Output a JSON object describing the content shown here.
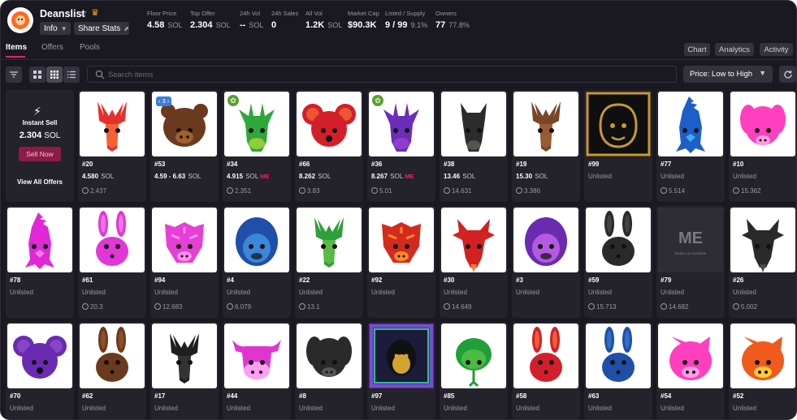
{
  "collection": {
    "name": "Deanslist",
    "info_label": "Info",
    "share_label": "Share Stats"
  },
  "stats": [
    {
      "label": "Floor Price",
      "value": "4.58",
      "unit": "SOL"
    },
    {
      "label": "Top Offer",
      "value": "2.304",
      "unit": "SOL"
    },
    {
      "label": "24h Vol",
      "value": "--",
      "unit": "SOL"
    },
    {
      "label": "24h Sales",
      "value": "0",
      "unit": ""
    },
    {
      "label": "All Vol",
      "value": "1.2K",
      "unit": "SOL"
    },
    {
      "label": "Market Cap",
      "value": "$90.3K",
      "unit": ""
    },
    {
      "label": "Listed / Supply",
      "value": "9 / 99",
      "unit": "9.1%"
    },
    {
      "label": "Owners",
      "value": "77",
      "unit": "77.8%"
    }
  ],
  "tabs": [
    "Items",
    "Offers",
    "Pools"
  ],
  "right_buttons": [
    "Chart",
    "Analytics",
    "Activity"
  ],
  "search": {
    "placeholder": "Search items"
  },
  "sort": {
    "selected": "Price: Low to High"
  },
  "instant_sell": {
    "title": "Instant Sell",
    "price": "2.304",
    "unit": "SOL",
    "button": "Sell Now",
    "view_all": "View All Offers"
  },
  "items": [
    {
      "num": "#20",
      "price": "4.580",
      "unit": "SOL",
      "rank": "2.437",
      "shape": "antler",
      "color": "#e5312e",
      "color2": "#ff8a3d"
    },
    {
      "num": "#53",
      "price": "4.59 - 6.63",
      "unit": "SOL",
      "rank": "",
      "shape": "bear",
      "color": "#6b3a1e",
      "color2": "#a0612f",
      "badge": "3"
    },
    {
      "num": "#34",
      "price": "4.915",
      "unit": "SOL",
      "me": "ME",
      "rank": "2.351",
      "shape": "giraffe",
      "color": "#2fa83a",
      "color2": "#d7e33a",
      "green": "true"
    },
    {
      "num": "#66",
      "price": "8.262",
      "unit": "SOL",
      "rank": "3.83",
      "shape": "mouse",
      "color": "#d31f2a",
      "color2": "#ff7b3a"
    },
    {
      "num": "#36",
      "price": "8.267",
      "unit": "SOL",
      "me": "ME",
      "rank": "5.01",
      "shape": "giraffe",
      "color": "#6b2db8",
      "color2": "#a74ad8",
      "green": "true"
    },
    {
      "num": "#38",
      "price": "13.46",
      "unit": "SOL",
      "rank": "14.631",
      "shape": "horse",
      "color": "#2c2c2c",
      "color2": "#555555"
    },
    {
      "num": "#19",
      "price": "15.30",
      "unit": "SOL",
      "rank": "3.386",
      "shape": "antler",
      "color": "#7a4628",
      "color2": "#b07040"
    },
    {
      "num": "#99",
      "status": "Unlisted",
      "shape": "gorilla-gold",
      "color": "#c99a2e",
      "color2": "#0f0f0f"
    },
    {
      "num": "#77",
      "status": "Unlisted",
      "rank": "5.514",
      "shape": "rooster",
      "color": "#1e5fc7",
      "color2": "#3bb0f0"
    },
    {
      "num": "#10",
      "status": "Unlisted",
      "rank": "15.362",
      "shape": "dog",
      "color": "#ff3fbe",
      "color2": "#ff9be6"
    },
    {
      "num": "#78",
      "status": "Unlisted",
      "shape": "rooster",
      "color": "#e028d6",
      "color2": "#ff7ce8"
    },
    {
      "num": "#61",
      "status": "Unlisted",
      "rank": "20.3",
      "shape": "rabbit",
      "color": "#e236d6",
      "color2": "#ff9af0"
    },
    {
      "num": "#94",
      "status": "Unlisted",
      "rank": "12.683",
      "shape": "tiger",
      "color": "#e53fd3",
      "color2": "#ff8df0"
    },
    {
      "num": "#4",
      "status": "Unlisted",
      "rank": "6.079",
      "shape": "gorilla",
      "color": "#1f4fa8",
      "color2": "#3b86d8"
    },
    {
      "num": "#22",
      "status": "Unlisted",
      "rank": "13.1",
      "shape": "antler",
      "color": "#2f9f3a",
      "color2": "#7bd14a"
    },
    {
      "num": "#92",
      "status": "Unlisted",
      "shape": "tiger",
      "color": "#d42a1e",
      "color2": "#ff8a2a"
    },
    {
      "num": "#30",
      "status": "Unlisted",
      "rank": "14.649",
      "shape": "goat",
      "color": "#d32020",
      "color2": "#ff7a3a"
    },
    {
      "num": "#3",
      "status": "Unlisted",
      "shape": "gorilla",
      "color": "#6a2bb0",
      "color2": "#b25ae0"
    },
    {
      "num": "#59",
      "status": "Unlisted",
      "rank": "15.713",
      "shape": "rabbit",
      "color": "#2a2a2a",
      "color2": "#555555"
    },
    {
      "num": "#79",
      "status": "Unlisted",
      "rank": "14.682",
      "shape": "placeholder",
      "color": "#2e2d33",
      "color2": "#7a7980",
      "ph_text": "Media not available"
    },
    {
      "num": "#26",
      "status": "Unlisted",
      "rank": "5.002",
      "shape": "goat",
      "color": "#2a2a2a",
      "color2": "#4a4a4a"
    },
    {
      "num": "#70",
      "status": "Unlisted",
      "shape": "mouse",
      "color": "#6a2bb0",
      "color2": "#9b59d8"
    },
    {
      "num": "#62",
      "status": "Unlisted",
      "shape": "rabbit",
      "color": "#6b3a1e",
      "color2": "#a0612f"
    },
    {
      "num": "#17",
      "status": "Unlisted",
      "shape": "antler",
      "color": "#1f1f1f",
      "color2": "#444444"
    },
    {
      "num": "#44",
      "status": "Unlisted",
      "shape": "cow",
      "color": "#e036d0",
      "color2": "#ff9ef2"
    },
    {
      "num": "#8",
      "status": "Unlisted",
      "shape": "dog",
      "color": "#2a2a2a",
      "color2": "#555555"
    },
    {
      "num": "#97",
      "status": "Unlisted",
      "shape": "gorilla-rainbow",
      "color": "#d4a52e",
      "color2": "#1b1b3a"
    },
    {
      "num": "#85",
      "status": "Unlisted",
      "shape": "snake",
      "color": "#1f9f3a",
      "color2": "#7ad84a"
    },
    {
      "num": "#58",
      "status": "Unlisted",
      "shape": "rabbit",
      "color": "#d31f2a",
      "color2": "#ff8a3d"
    },
    {
      "num": "#63",
      "status": "Unlisted",
      "shape": "rabbit",
      "color": "#1f4fa8",
      "color2": "#3b86d8"
    },
    {
      "num": "#54",
      "status": "Unlisted",
      "shape": "pig",
      "color": "#ff3fbe",
      "color2": "#ff9be6"
    },
    {
      "num": "#52",
      "status": "Unlisted",
      "shape": "pig",
      "color": "#f05a1a",
      "color2": "#ffc93a"
    }
  ],
  "icons": {
    "star": "star-outline-icon",
    "crown": "crown-icon",
    "search": "search-icon",
    "filter": "filter-icon",
    "refresh": "refresh-icon",
    "bolt": "lightning-icon",
    "rank": "rarity-icon"
  },
  "colors": {
    "background": "#1a1820",
    "card": "#24222b",
    "accent": "#e42575",
    "muted": "#9a98a3",
    "button": "#34323c"
  }
}
